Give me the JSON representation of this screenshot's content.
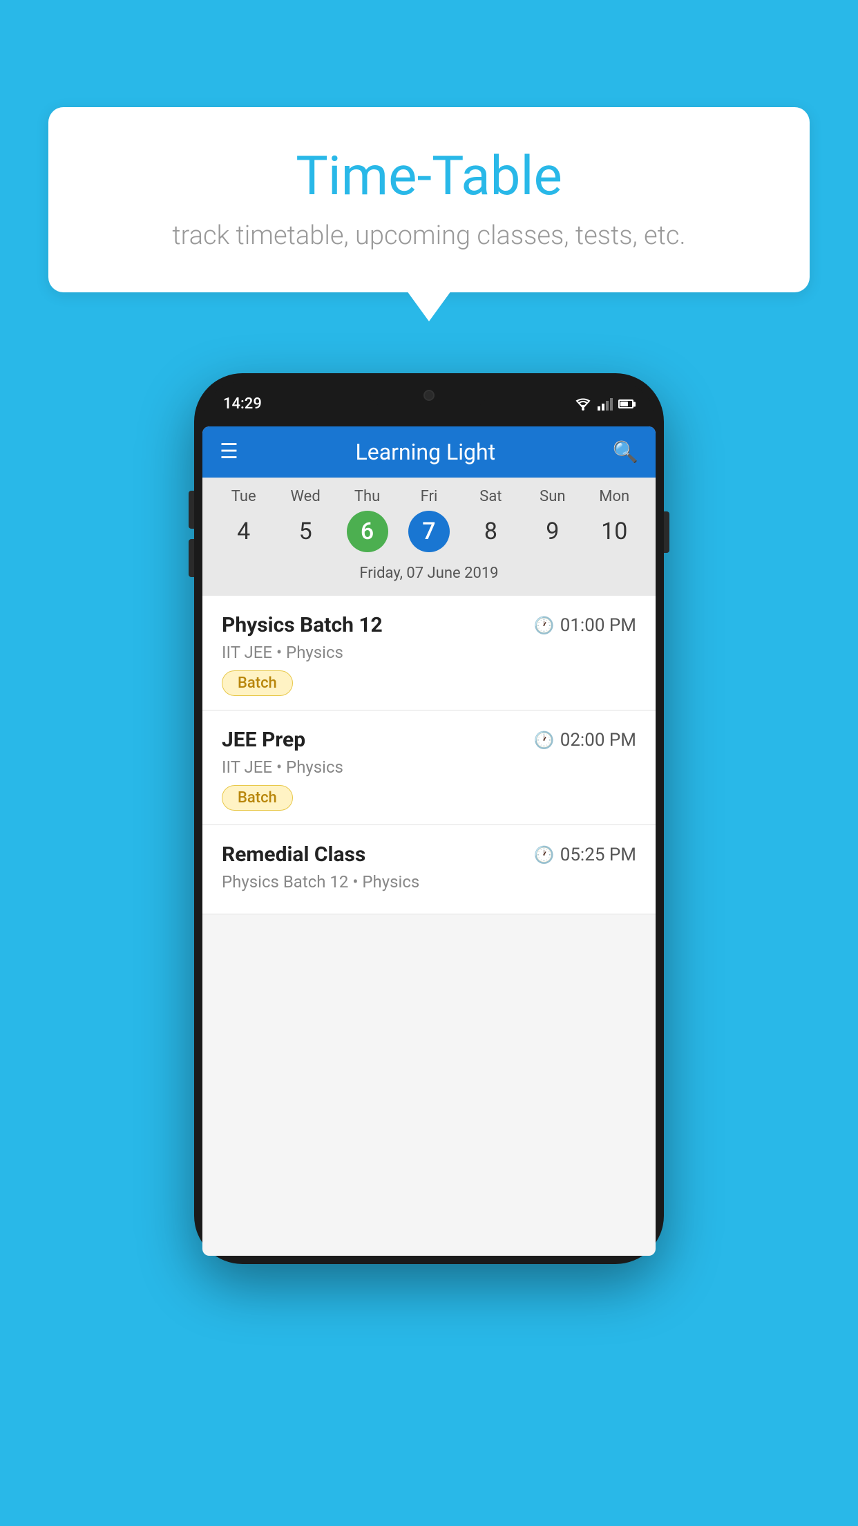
{
  "background_color": "#29B8E8",
  "bubble": {
    "title": "Time-Table",
    "subtitle": "track timetable, upcoming classes, tests, etc."
  },
  "phone": {
    "status_bar": {
      "time": "14:29"
    },
    "app_header": {
      "title": "Learning Light"
    },
    "calendar": {
      "days": [
        {
          "name": "Tue",
          "num": "4",
          "state": "normal"
        },
        {
          "name": "Wed",
          "num": "5",
          "state": "normal"
        },
        {
          "name": "Thu",
          "num": "6",
          "state": "today"
        },
        {
          "name": "Fri",
          "num": "7",
          "state": "selected"
        },
        {
          "name": "Sat",
          "num": "8",
          "state": "normal"
        },
        {
          "name": "Sun",
          "num": "9",
          "state": "normal"
        },
        {
          "name": "Mon",
          "num": "10",
          "state": "normal"
        }
      ],
      "selected_date_label": "Friday, 07 June 2019"
    },
    "schedule_items": [
      {
        "name": "Physics Batch 12",
        "time": "01:00 PM",
        "detail": "IIT JEE • Physics",
        "badge": "Batch"
      },
      {
        "name": "JEE Prep",
        "time": "02:00 PM",
        "detail": "IIT JEE • Physics",
        "badge": "Batch"
      },
      {
        "name": "Remedial Class",
        "time": "05:25 PM",
        "detail": "Physics Batch 12 • Physics",
        "badge": null
      }
    ]
  }
}
